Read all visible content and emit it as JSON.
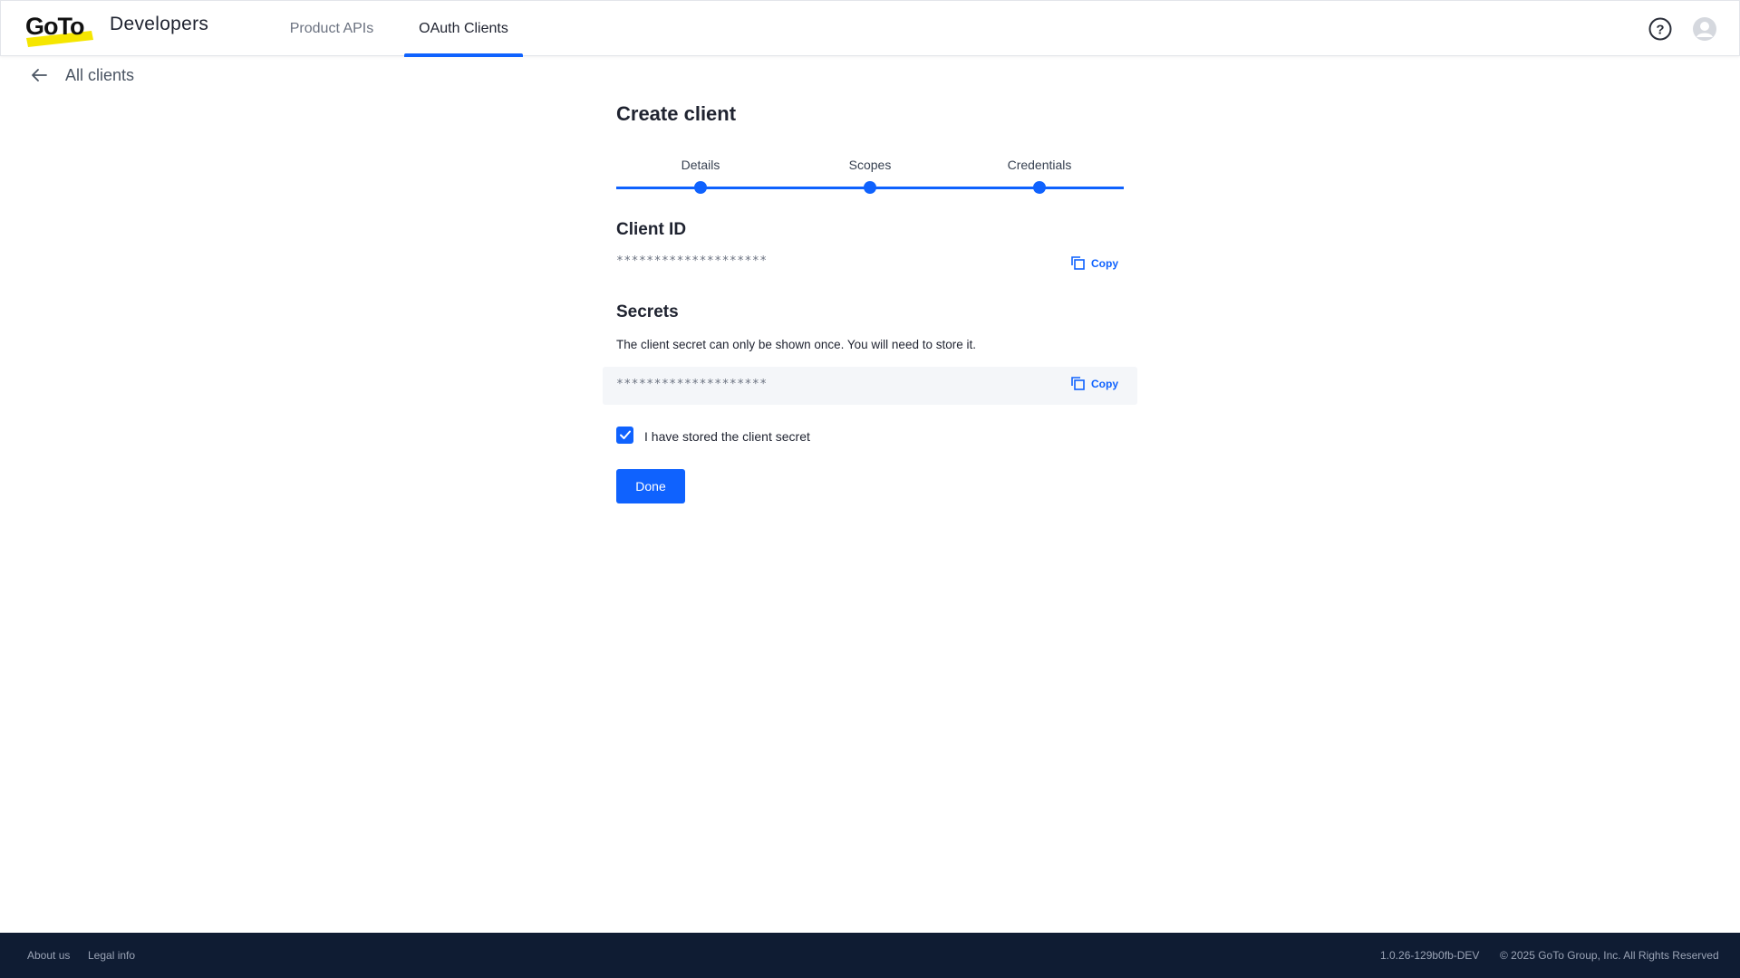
{
  "header": {
    "brand": "Developers",
    "logo_text": "GoTo",
    "tabs": [
      {
        "label": "Product APIs",
        "active": false
      },
      {
        "label": "OAuth Clients",
        "active": true
      }
    ]
  },
  "back_link": {
    "label": "All clients"
  },
  "page": {
    "title": "Create client",
    "steps": [
      {
        "label": "Details"
      },
      {
        "label": "Scopes"
      },
      {
        "label": "Credentials"
      }
    ],
    "client_id": {
      "title": "Client ID",
      "value": "********************",
      "copy_label": "Copy"
    },
    "secrets": {
      "title": "Secrets",
      "hint": "The client secret can only be shown once. You will need to store it.",
      "value": "********************",
      "copy_label": "Copy"
    },
    "stored_checkbox": {
      "label": "I have stored the client secret",
      "checked": true
    },
    "done_label": "Done"
  },
  "footer": {
    "about": "About us",
    "legal": "Legal info",
    "version": "1.0.26-129b0fb-DEV",
    "copyright": "© 2025 GoTo Group, Inc. All Rights Reserved"
  },
  "colors": {
    "accent": "#0f62fe",
    "footer_bg": "#0f1c33",
    "logo_highlight": "#f5e600"
  }
}
